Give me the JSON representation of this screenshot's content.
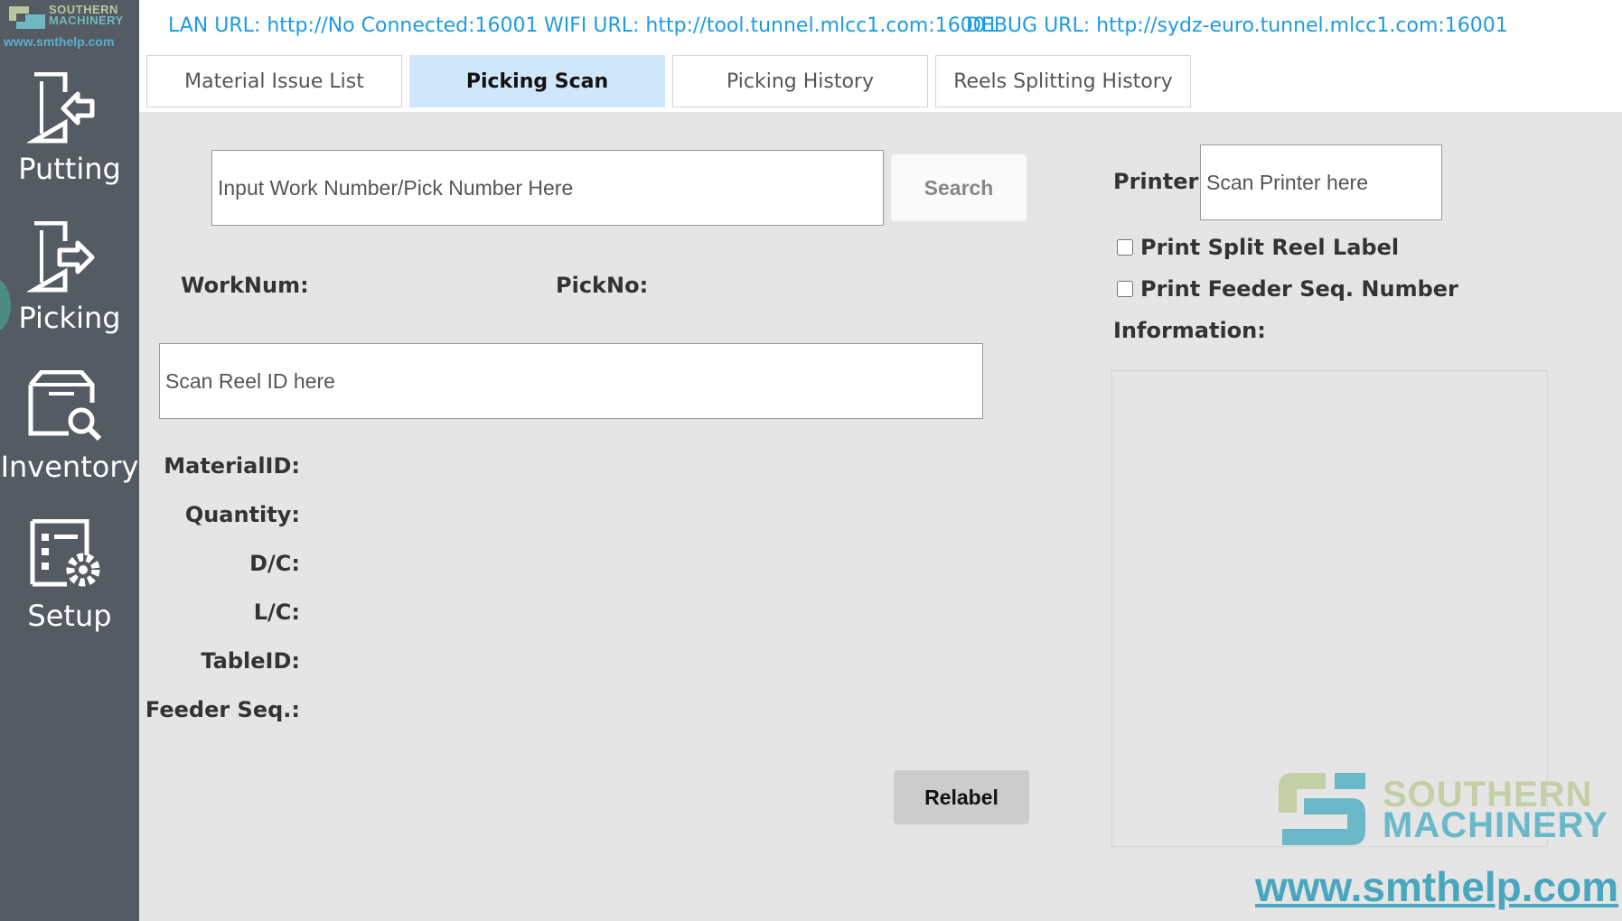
{
  "brand": {
    "logo_line1": "SOUTHERN",
    "logo_line2": "MACHINERY",
    "logo_url": "www.smthelp.com",
    "colors": {
      "green": "#b9c7a0",
      "teal": "#6fb8c4",
      "link": "#1e9be0",
      "sidebar": "#545b63",
      "active_tab": "#cfe6fb"
    }
  },
  "sidebar": {
    "items": [
      {
        "label": "Putting",
        "icon": "putting-icon"
      },
      {
        "label": "Picking",
        "icon": "picking-icon",
        "active": true
      },
      {
        "label": "Inventory",
        "icon": "inventory-icon"
      },
      {
        "label": "Setup",
        "icon": "setup-icon"
      }
    ]
  },
  "topbar": {
    "lan": "LAN URL:  http://No Connected:16001",
    "wifi": "WIFI URL:  http://tool.tunnel.mlcc1.com:16001",
    "debug": "DEBUG URL:  http://sydz-euro.tunnel.mlcc1.com:16001"
  },
  "tabs": [
    {
      "label": "Material Issue List"
    },
    {
      "label": "Picking Scan",
      "active": true
    },
    {
      "label": "Picking History"
    },
    {
      "label": "Reels Splitting History"
    }
  ],
  "main": {
    "work_input_placeholder": "Input Work Number/Pick Number Here",
    "search_label": "Search",
    "worknum_label": "WorkNum:",
    "pickno_label": "PickNo:",
    "reel_input_placeholder": "Scan Reel ID here",
    "fields": {
      "material_id": "MaterialID:",
      "quantity": "Quantity:",
      "dc": "D/C:",
      "lc": "L/C:",
      "table_id": "TableID:",
      "feeder_seq": "Feeder Seq.:"
    },
    "relabel_label": "Relabel"
  },
  "right": {
    "printer_label": "Printer:",
    "printer_placeholder": "Scan Printer here",
    "print_split_label": "Print Split Reel Label",
    "print_feeder_label": "Print Feeder Seq. Number",
    "information_label": "Information:"
  },
  "watermark": {
    "line1": "SOUTHERN",
    "line2": "MACHINERY",
    "url": "www.smthelp.com"
  }
}
